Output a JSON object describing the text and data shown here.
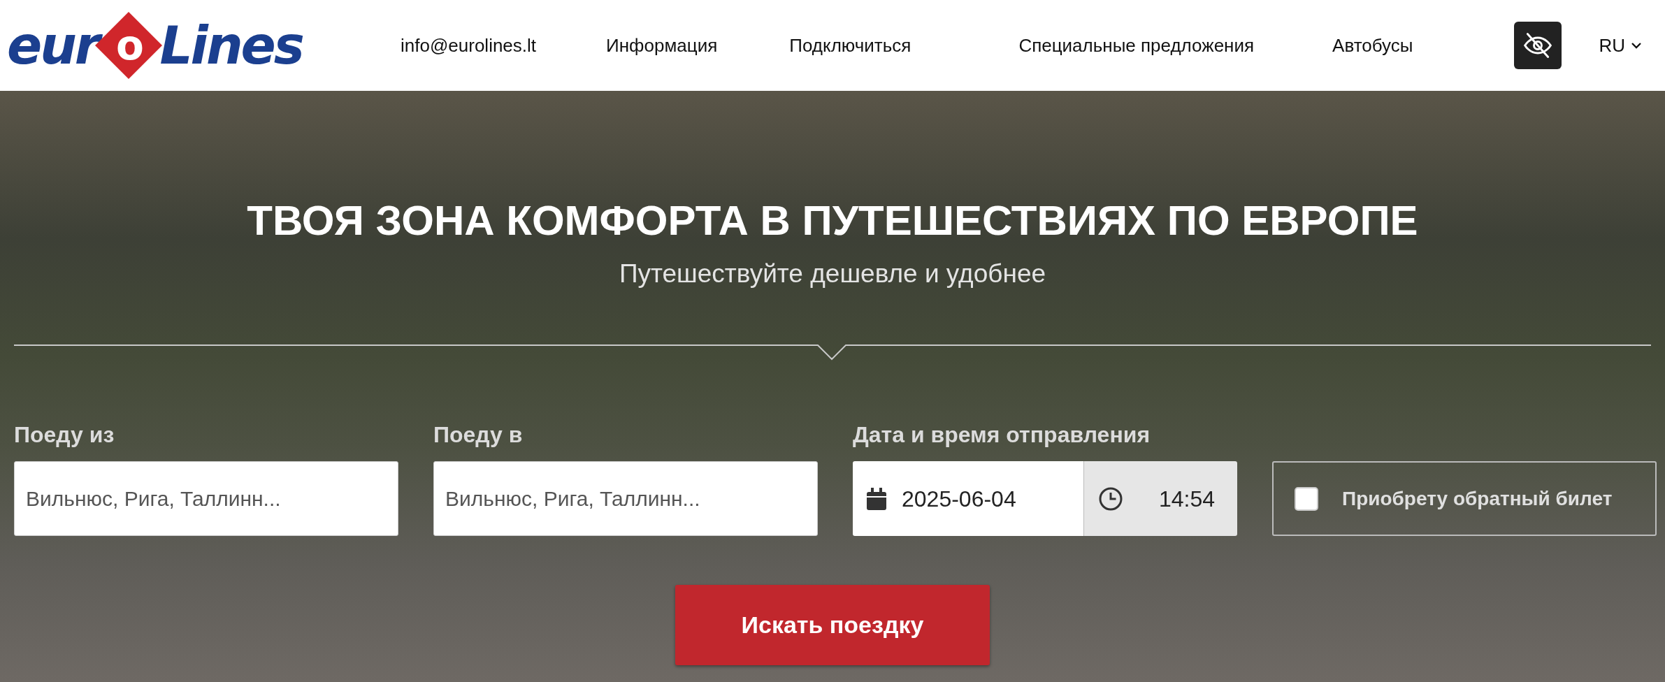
{
  "header": {
    "logo": {
      "part_left": "eur",
      "part_circle": "o",
      "part_right": "Lines"
    },
    "nav": [
      {
        "label": "info@eurolines.lt"
      },
      {
        "label": "Информация"
      },
      {
        "label": "Подключиться"
      },
      {
        "label": "Специальные предложения"
      },
      {
        "label": "Автобусы"
      }
    ],
    "language": {
      "label": "RU"
    }
  },
  "hero": {
    "title": "ТВОЯ ЗОНА КОМФОРТА В ПУТЕШЕСТВИЯХ ПО ЕВРОПЕ",
    "subtitle": "Путешествуйте дешевле и удобнее"
  },
  "search_form": {
    "from": {
      "label": "Поеду из",
      "placeholder": "Вильнюс, Рига, Таллинн..."
    },
    "to": {
      "label": "Поеду в",
      "placeholder": "Вильнюс, Рига, Таллинн..."
    },
    "departure": {
      "label": "Дата и время отправления",
      "date": "2025-06-04",
      "time": "14:54"
    },
    "return_ticket": {
      "label": "Приобрету обратный билет",
      "checked": false
    },
    "submit": "Искать поездку"
  }
}
